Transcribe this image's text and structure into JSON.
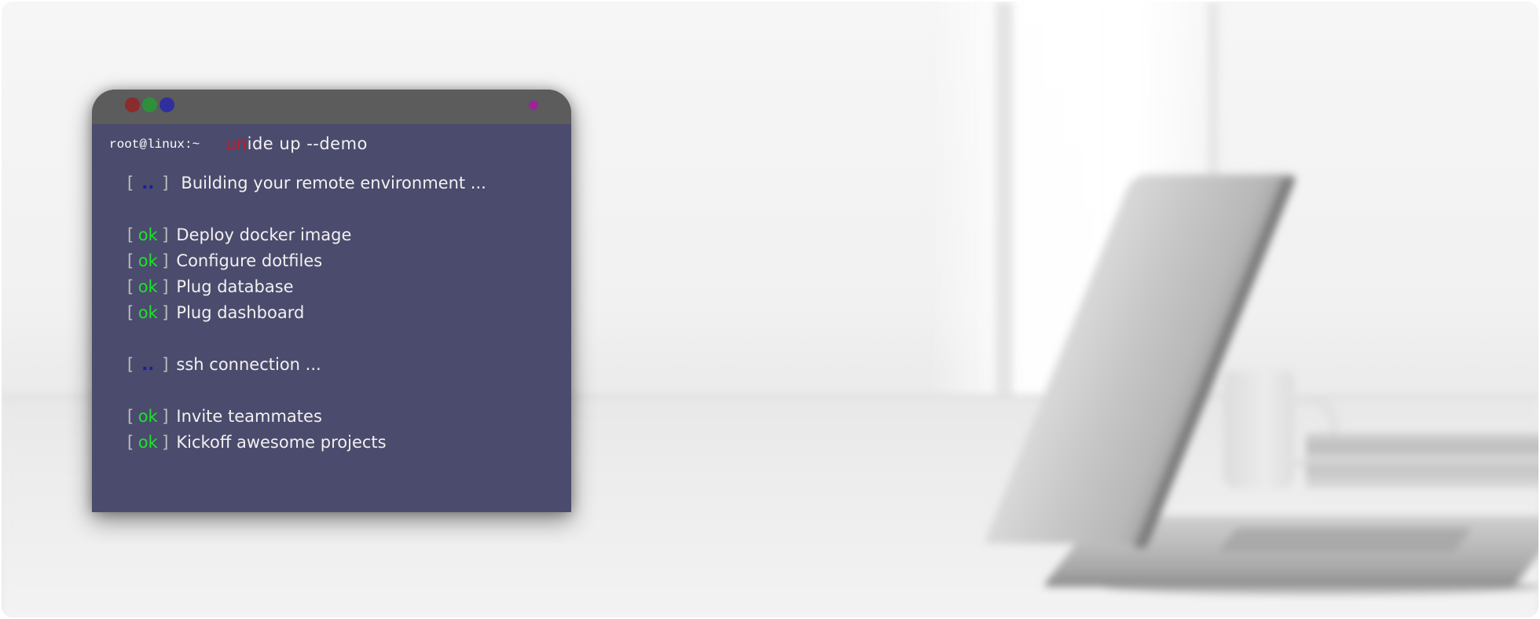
{
  "terminal": {
    "prompt": "root@linux:~",
    "command_brand": "un",
    "command_rest": "ide up --demo",
    "lines": [
      {
        "status": "..",
        "message": "Building your remote environment ..."
      },
      {
        "status": "ok",
        "message": "Deploy docker image"
      },
      {
        "status": "ok",
        "message": "Configure dotfiles"
      },
      {
        "status": "ok",
        "message": "Plug database"
      },
      {
        "status": "ok",
        "message": "Plug dashboard"
      },
      {
        "status": "..",
        "message": "ssh connection ..."
      },
      {
        "status": "ok",
        "message": "Invite teammates"
      },
      {
        "status": "ok",
        "message": "Kickoff awesome projects"
      }
    ],
    "bracket_open": "[",
    "bracket_close": "]"
  },
  "colors": {
    "terminal_bg": "#4b4b6d",
    "titlebar": "#5c5c5c",
    "brand_red": "#c21a2a",
    "status_ok": "#19e628",
    "status_pending": "#1c1ca8",
    "dot_red": "#8b2b2b",
    "dot_green": "#2f8f3a",
    "dot_blue": "#2f2f9f",
    "dot_purple": "#9b249b"
  },
  "icons": {
    "close": "red-dot-icon",
    "minimize": "green-dot-icon",
    "maximize": "blue-dot-icon",
    "menu": "purple-dot-icon"
  }
}
